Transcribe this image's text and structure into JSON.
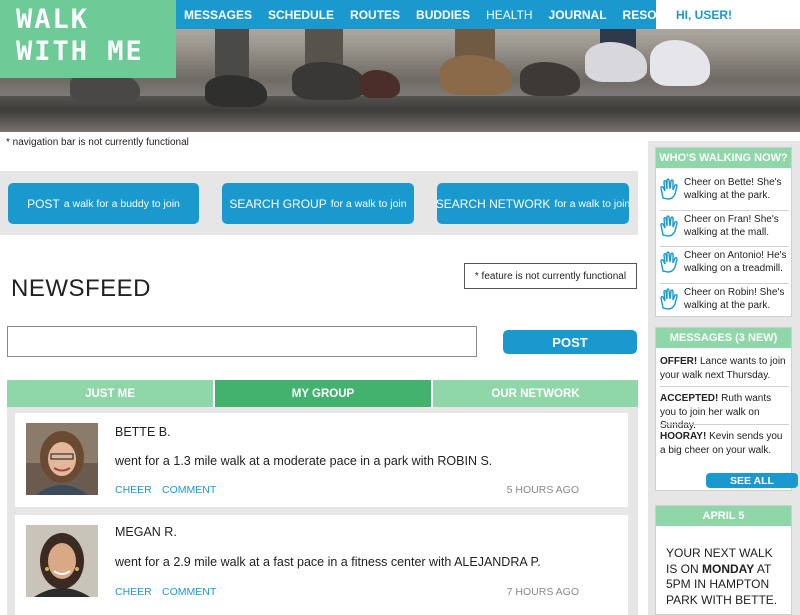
{
  "logo": {
    "line1": "WALK",
    "line2": "WITH ME"
  },
  "nav": {
    "items": [
      "MESSAGES",
      "SCHEDULE",
      "ROUTES",
      "BUDDIES",
      "HEALTH",
      "JOURNAL",
      "RESOURCES"
    ],
    "greeting": "HI, USER!"
  },
  "nav_note": "* navigation bar is not currently functional",
  "actions": [
    {
      "main": "POST",
      "rest": "a walk for a buddy to join"
    },
    {
      "main": "SEARCH GROUP",
      "rest": "for a walk to join"
    },
    {
      "main": "SEARCH NETWORK",
      "rest": "for a walk to join"
    }
  ],
  "newsfeed": {
    "title": "NEWSFEED",
    "feature_note": "* feature is not currently functional",
    "input_placeholder": "",
    "post_label": "POST"
  },
  "tabs": [
    {
      "label": "JUST ME",
      "active": false
    },
    {
      "label": "MY GROUP",
      "active": true
    },
    {
      "label": "OUR NETWORK",
      "active": false
    }
  ],
  "posts": [
    {
      "name": "BETTE B.",
      "text_pre": "went for a 1.3 mile walk at a moderate pace in a park with ",
      "buddy": "ROBIN S.",
      "cheer": "CHEER",
      "comment": "COMMENT",
      "time": "5 HOURS AGO"
    },
    {
      "name": "MEGAN R.",
      "text_pre": "went for a 2.9 mile walk at a fast pace in a fitness center with ",
      "buddy": "ALEJANDRA P.",
      "cheer": "CHEER",
      "comment": "COMMENT",
      "time": "7 HOURS AGO"
    }
  ],
  "walking_now": {
    "title": "WHO'S WALKING NOW?",
    "items": [
      {
        "pre": "Cheer on ",
        "name": "Bette",
        "post": "! She's walking at the park."
      },
      {
        "pre": "Cheer on ",
        "name": "Fran",
        "post": "! She's walking at the mall."
      },
      {
        "pre": "Cheer on ",
        "name": "Antonio",
        "post": "! He's walking on a treadmill."
      },
      {
        "pre": "Cheer on ",
        "name": "Robin",
        "post": "! She's walking at the park."
      }
    ]
  },
  "messages": {
    "title": "MESSAGES (3 NEW)",
    "items": [
      {
        "lead": "OFFER!",
        "rest": " Lance wants to join your walk next Thursday."
      },
      {
        "lead": "ACCEPTED!",
        "rest": " Ruth wants you to join her walk on Sunday."
      },
      {
        "lead": "HOORAY!",
        "rest": " Kevin sends you a big cheer on your walk."
      }
    ],
    "see_all": "SEE ALL"
  },
  "calendar": {
    "date": "APRIL 5",
    "t1": "YOUR NEXT WALK IS ON ",
    "day": "MONDAY",
    "t2": " AT 5PM IN HAMPTON PARK WITH BETTE."
  },
  "colors": {
    "blue": "#1a99cf",
    "green": "#6ccb96",
    "light_green": "#8fd6a8",
    "active_green": "#43b26f"
  }
}
